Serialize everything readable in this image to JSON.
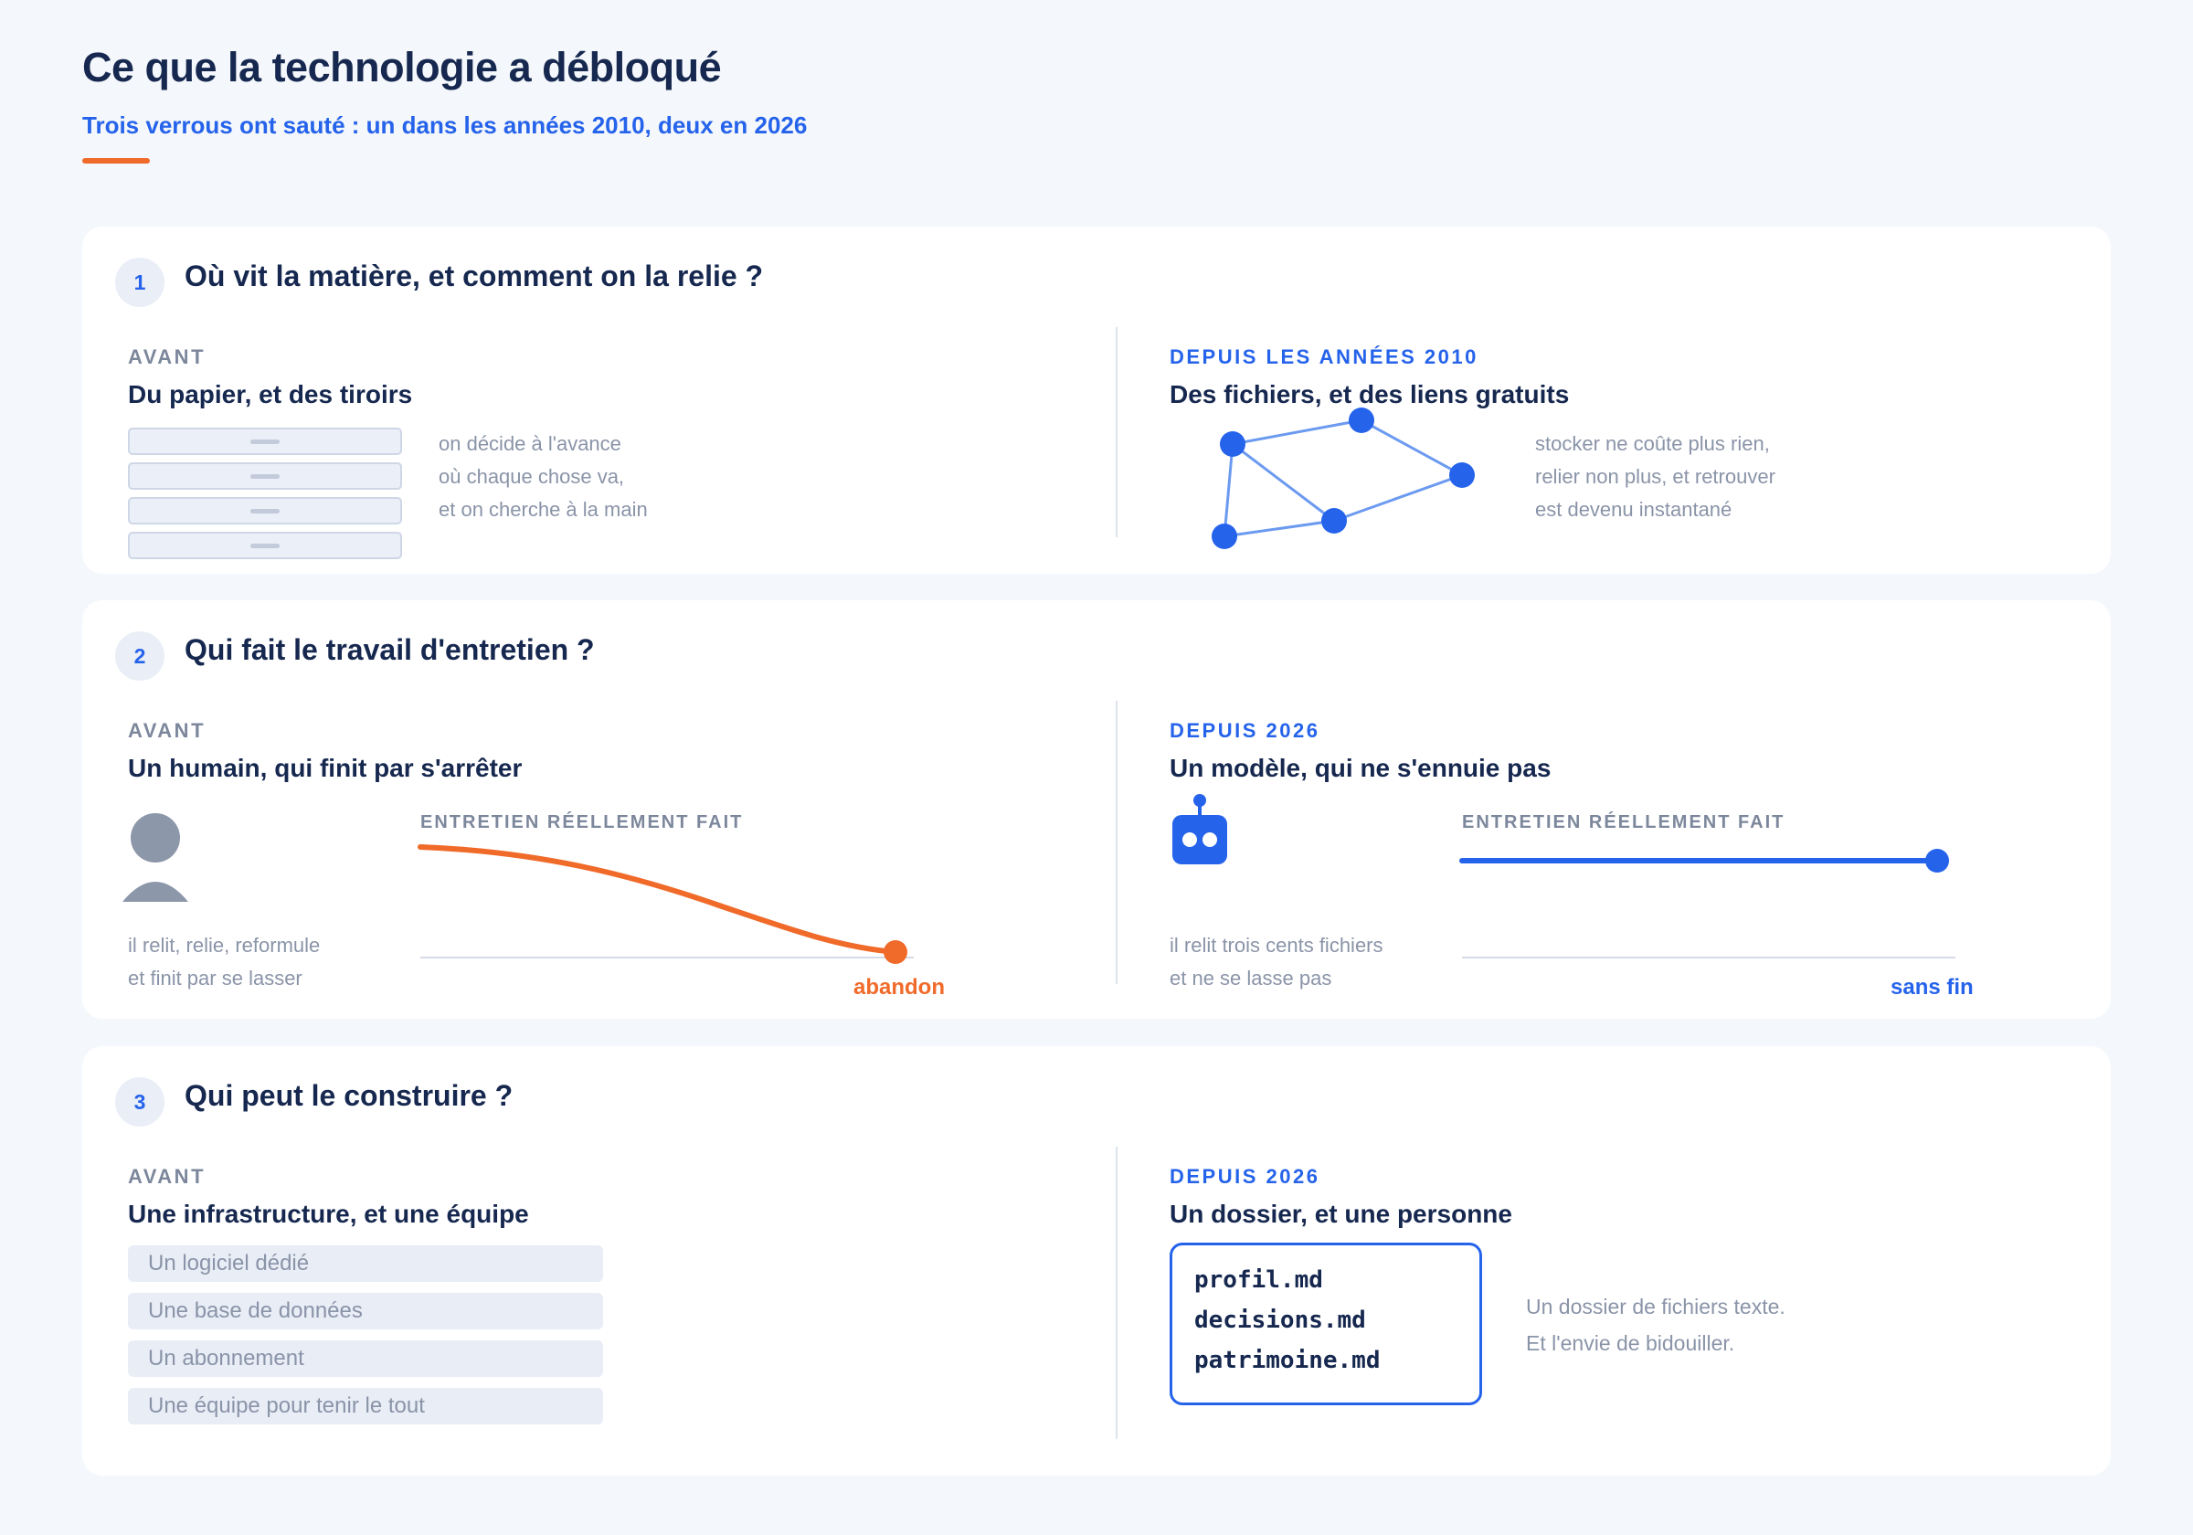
{
  "header": {
    "title": "Ce que la technologie a débloqué",
    "subtitle": "Trois verrous ont sauté : un dans les années 2010, deux en 2026",
    "accent_color": "#f06a2a"
  },
  "colors": {
    "primary_blue": "#2563eb",
    "accent_orange": "#f06a2a",
    "muted_grey": "#8a94a8",
    "dark_text": "#16284f"
  },
  "sections": [
    {
      "number": "1",
      "title": "Où vit la matière, et comment on la relie ?",
      "before": {
        "kicker": "AVANT",
        "title": "Du papier, et des tiroirs",
        "description": [
          "on décide à l'avance",
          "où chaque chose va,",
          "et on cherche à la main"
        ],
        "illustration": "drawer-stack-icon"
      },
      "after": {
        "kicker": "DEPUIS LES ANNÉES 2010",
        "title": "Des fichiers, et des liens gratuits",
        "description": [
          "stocker ne coûte plus rien,",
          "relier non plus, et retrouver",
          "est devenu instantané"
        ],
        "illustration": "node-graph-icon"
      }
    },
    {
      "number": "2",
      "title": "Qui fait le travail d'entretien ?",
      "before": {
        "kicker": "AVANT",
        "title": "Un humain, qui finit par s'arrêter",
        "description": [
          "il relit, relie, reformule",
          "et finit par se lasser"
        ],
        "illustration": "person-icon",
        "chart_label": "ENTRETIEN RÉELLEMENT FAIT",
        "end_label": "abandon"
      },
      "after": {
        "kicker": "DEPUIS 2026",
        "title": "Un modèle, qui ne s'ennuie pas",
        "description": [
          "il relit trois cents fichiers",
          "et ne se lasse pas"
        ],
        "illustration": "robot-icon",
        "chart_label": "ENTRETIEN RÉELLEMENT FAIT",
        "end_label": "sans fin"
      }
    },
    {
      "number": "3",
      "title": "Qui peut le construire ?",
      "before": {
        "kicker": "AVANT",
        "title": "Une infrastructure, et une équipe",
        "items": [
          "Un logiciel dédié",
          "Une base de données",
          "Un abonnement",
          "Une équipe pour tenir le tout"
        ]
      },
      "after": {
        "kicker": "DEPUIS 2026",
        "title": "Un dossier, et une personne",
        "files": [
          "profil.md",
          "decisions.md",
          "patrimoine.md"
        ],
        "description": [
          "Un dossier de fichiers texte.",
          "Et l'envie de bidouiller."
        ]
      }
    }
  ]
}
